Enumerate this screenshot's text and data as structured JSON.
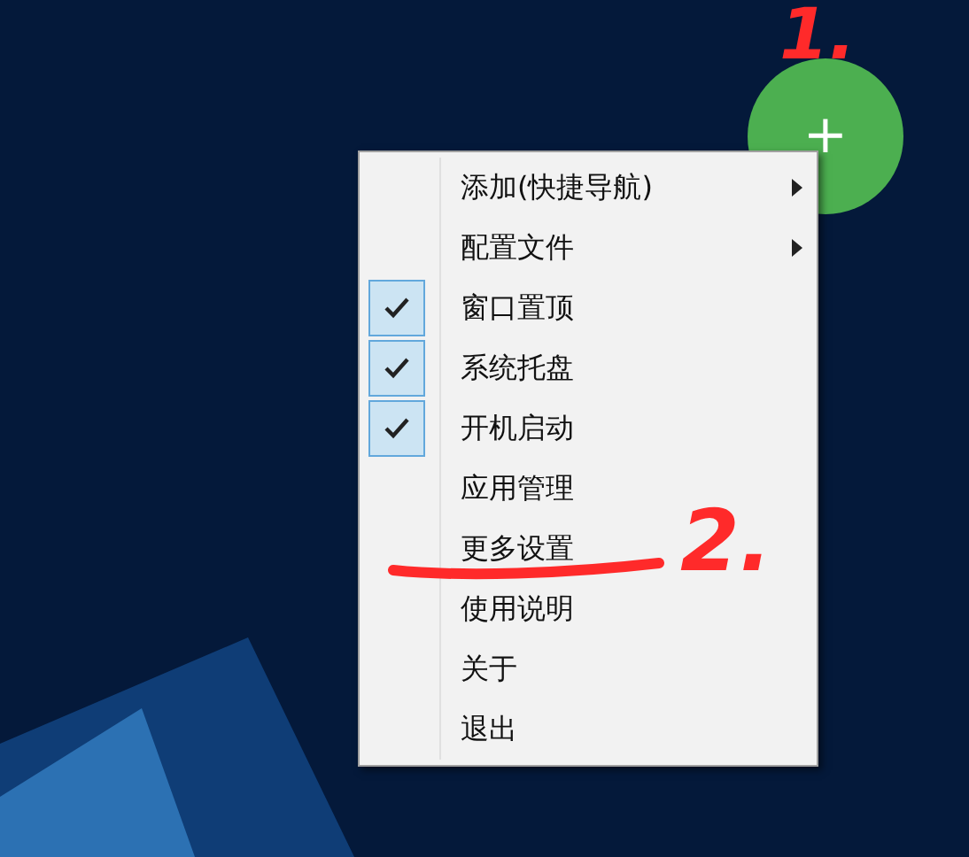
{
  "menu": {
    "items": [
      {
        "label": "添加(快捷导航)",
        "kind": "submenu",
        "checked": false
      },
      {
        "label": "配置文件",
        "kind": "submenu",
        "checked": false
      },
      {
        "label": "窗口置顶",
        "kind": "check",
        "checked": true
      },
      {
        "label": "系统托盘",
        "kind": "check",
        "checked": true
      },
      {
        "label": "开机启动",
        "kind": "check",
        "checked": true
      },
      {
        "label": "应用管理",
        "kind": "plain",
        "checked": false
      },
      {
        "label": "更多设置",
        "kind": "plain",
        "checked": false
      },
      {
        "label": "使用说明",
        "kind": "plain",
        "checked": false
      },
      {
        "label": "关于",
        "kind": "plain",
        "checked": false
      },
      {
        "label": "退出",
        "kind": "plain",
        "checked": false
      }
    ]
  },
  "floating_button": {
    "symbol": "+"
  },
  "annotations": [
    {
      "text": "1."
    },
    {
      "text": "2."
    }
  ]
}
